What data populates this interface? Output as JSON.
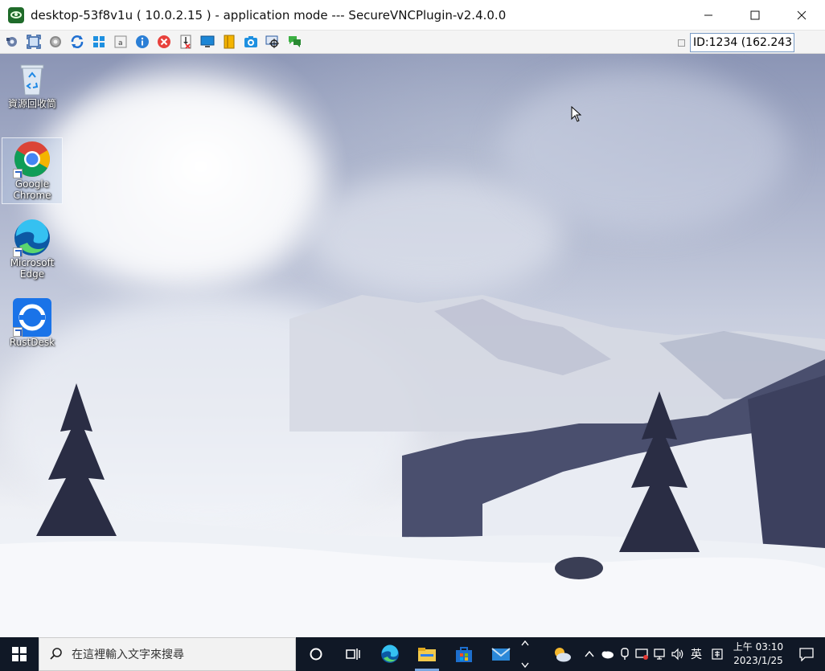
{
  "window": {
    "title": "desktop-53f8v1u ( 10.0.2.15 ) - application mode --- SecureVNCPlugin-v2.4.0.0"
  },
  "toolbar": {
    "id_field_value": "ID:1234 (162.243",
    "icons": [
      "send-keys-icon",
      "fullscreen-icon",
      "settings-icon",
      "refresh-icon",
      "windows-key-icon",
      "text-chat-icon",
      "info-icon",
      "close-connection-icon",
      "file-transfer-icon",
      "monitor-icon",
      "notepad-icon",
      "screenshot-icon",
      "viewonly-icon",
      "chat-icon"
    ]
  },
  "desktop": {
    "icons": [
      {
        "label": "資源回收筒",
        "icon": "recycle-bin-icon"
      },
      {
        "label": "Google Chrome",
        "icon": "chrome-icon"
      },
      {
        "label": "Microsoft Edge",
        "icon": "edge-icon"
      },
      {
        "label": "RustDesk",
        "icon": "rustdesk-icon"
      }
    ]
  },
  "taskbar": {
    "search_placeholder": "在這裡輸入文字來搜尋",
    "ime_label": "英",
    "clock_time": "上午 03:10",
    "clock_date": "2023/1/25"
  },
  "colors": {
    "taskbar_bg": "#101826",
    "chrome_red": "#db4437",
    "chrome_green": "#0f9d58",
    "chrome_yellow": "#f4b400",
    "chrome_blue": "#4285f4",
    "rustdesk_blue": "#1a73e8"
  }
}
